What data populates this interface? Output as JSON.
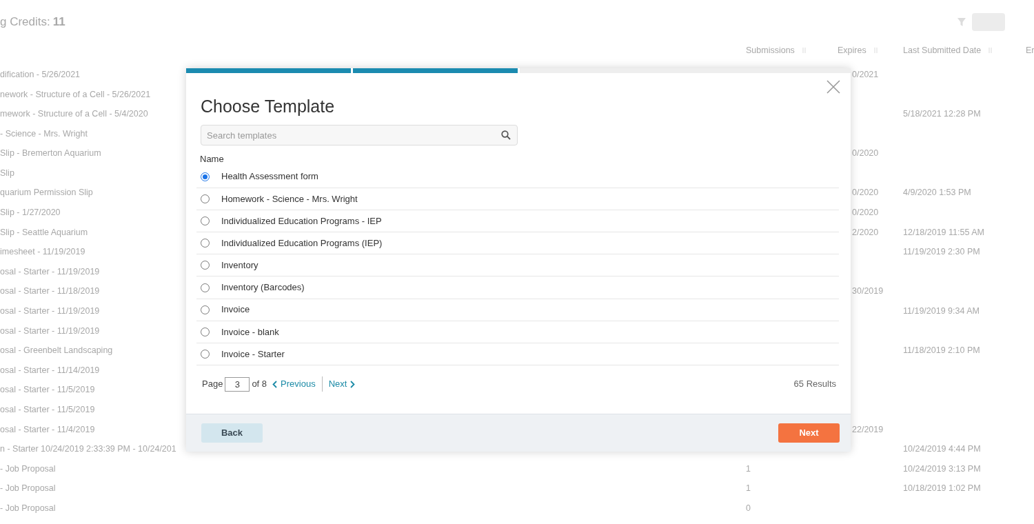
{
  "page": {
    "credits_label": "g Credits:",
    "credits_value": "11",
    "columns": [
      {
        "label": "Submissions"
      },
      {
        "label": "Expires"
      },
      {
        "label": "Last Submitted Date"
      },
      {
        "label": "Er"
      }
    ],
    "rows": [
      {
        "name": "dification - 5/26/2021",
        "submissions": "",
        "expires": "0/2021",
        "last_submitted": ""
      },
      {
        "name": "nework - Structure of a Cell - 5/26/2021",
        "submissions": "",
        "expires": "",
        "last_submitted": ""
      },
      {
        "name": "mework - Structure of a Cell - 5/4/2020",
        "submissions": "",
        "expires": "",
        "last_submitted": "5/18/2021 12:28 PM"
      },
      {
        "name": "- Science - Mrs. Wright",
        "submissions": "",
        "expires": "",
        "last_submitted": ""
      },
      {
        "name": "Slip - Bremerton Aquarium",
        "submissions": "",
        "expires": "0/2020",
        "last_submitted": ""
      },
      {
        "name": "Slip",
        "submissions": "",
        "expires": "",
        "last_submitted": ""
      },
      {
        "name": "quarium Permission Slip",
        "submissions": "",
        "expires": "0/2020",
        "last_submitted": "4/9/2020 1:53 PM"
      },
      {
        "name": "Slip - 1/27/2020",
        "submissions": "",
        "expires": "0/2020",
        "last_submitted": ""
      },
      {
        "name": "Slip - Seattle Aquarium",
        "submissions": "",
        "expires": "2/2020",
        "last_submitted": "12/18/2019 11:55 AM"
      },
      {
        "name": "imesheet - 11/19/2019",
        "submissions": "",
        "expires": "",
        "last_submitted": "11/19/2019 2:30 PM"
      },
      {
        "name": "osal - Starter - 11/19/2019",
        "submissions": "",
        "expires": "",
        "last_submitted": ""
      },
      {
        "name": "osal - Starter - 11/18/2019",
        "submissions": "",
        "expires": "30/2019",
        "last_submitted": ""
      },
      {
        "name": "osal - Starter - 11/19/2019",
        "submissions": "",
        "expires": "",
        "last_submitted": "11/19/2019 9:34 AM"
      },
      {
        "name": "osal - Starter - 11/19/2019",
        "submissions": "",
        "expires": "",
        "last_submitted": ""
      },
      {
        "name": "osal - Greenbelt Landscaping",
        "submissions": "",
        "expires": "",
        "last_submitted": "11/18/2019 2:10 PM"
      },
      {
        "name": "osal - Starter - 11/14/2019",
        "submissions": "",
        "expires": "",
        "last_submitted": ""
      },
      {
        "name": "osal - Starter - 11/5/2019",
        "submissions": "",
        "expires": "",
        "last_submitted": ""
      },
      {
        "name": "osal - Starter - 11/5/2019",
        "submissions": "",
        "expires": "",
        "last_submitted": ""
      },
      {
        "name": "osal - Starter - 11/4/2019",
        "submissions": "",
        "expires": "22/2019",
        "last_submitted": ""
      },
      {
        "name": "n - Starter 10/24/2019 2:33:39 PM - 10/24/201",
        "submissions": "",
        "expires": "",
        "last_submitted": "10/24/2019 4:44 PM"
      },
      {
        "name": "- Job Proposal",
        "submissions": "1",
        "expires": "",
        "last_submitted": "10/24/2019 3:13 PM"
      },
      {
        "name": "- Job Proposal",
        "submissions": "1",
        "expires": "",
        "last_submitted": "10/18/2019 1:02 PM"
      },
      {
        "name": "- Job Proposal",
        "submissions": "0",
        "expires": "",
        "last_submitted": ""
      }
    ]
  },
  "modal": {
    "steps": [
      {
        "complete": true
      },
      {
        "complete": true
      },
      {
        "complete": false
      }
    ],
    "title": "Choose Template",
    "search": {
      "placeholder": "Search templates"
    },
    "column": "Name",
    "templates": [
      {
        "name": "Health Assessment form",
        "selected": true
      },
      {
        "name": "Homework - Science - Mrs. Wright",
        "selected": false
      },
      {
        "name": "Individualized Education Programs - IEP",
        "selected": false
      },
      {
        "name": "Individualized Education Programs (IEP)",
        "selected": false
      },
      {
        "name": "Inventory",
        "selected": false
      },
      {
        "name": "Inventory (Barcodes)",
        "selected": false
      },
      {
        "name": "Invoice",
        "selected": false
      },
      {
        "name": "Invoice - blank",
        "selected": false
      },
      {
        "name": "Invoice - Starter",
        "selected": false
      }
    ],
    "pagination": {
      "page_label": "Page",
      "page": "3",
      "of": "of 8",
      "previous": "Previous",
      "next": "Next",
      "results": "65 Results"
    },
    "buttons": {
      "back": "Back",
      "next": "Next"
    }
  }
}
